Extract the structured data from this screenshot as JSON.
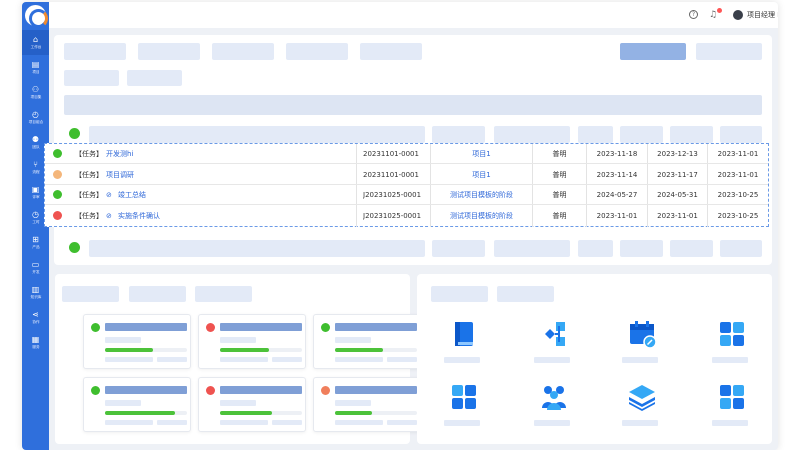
{
  "header": {
    "help_icon": "help-circle-icon",
    "bell_icon": "bell-icon",
    "username": "项目经理 PM"
  },
  "sidebar": {
    "items": [
      {
        "label": "工作台",
        "icon": "home-icon",
        "glyph": "⌂",
        "active": true
      },
      {
        "label": "项目",
        "icon": "project-icon",
        "glyph": "▤",
        "active": false
      },
      {
        "label": "项目集",
        "icon": "program-icon",
        "glyph": "⚇",
        "active": false
      },
      {
        "label": "项目组合",
        "icon": "portfolio-icon",
        "glyph": "◴",
        "active": false
      },
      {
        "label": "团队",
        "icon": "team-icon",
        "glyph": "⚉",
        "active": false
      },
      {
        "label": "流程",
        "icon": "flow-icon",
        "glyph": "⑂",
        "active": false
      },
      {
        "label": "评审",
        "icon": "review-icon",
        "glyph": "▣",
        "active": false
      },
      {
        "label": "工时",
        "icon": "clock-icon",
        "glyph": "◷",
        "active": false
      },
      {
        "label": "产品",
        "icon": "product-icon",
        "glyph": "⊞",
        "active": false
      },
      {
        "label": "开发",
        "icon": "terminal-icon",
        "glyph": "▭",
        "active": false
      },
      {
        "label": "知识库",
        "icon": "book-icon",
        "glyph": "▥",
        "active": false
      },
      {
        "label": "协作",
        "icon": "share-icon",
        "glyph": "⋖",
        "active": false
      },
      {
        "label": "服务",
        "icon": "service-icon",
        "glyph": "▦",
        "active": false
      }
    ]
  },
  "tasks": [
    {
      "status": "green",
      "type": "【任务】",
      "icon": "",
      "title": "开发测hi",
      "code": "20231101-0001",
      "project": "项目1",
      "owner": "普明",
      "start": "2023-11-18",
      "end": "2023-12-13",
      "created": "2023-11-01"
    },
    {
      "status": "orange",
      "type": "【任务】",
      "icon": "",
      "title": "项目调研",
      "code": "20231101-0001",
      "project": "项目1",
      "owner": "普明",
      "start": "2023-11-14",
      "end": "2023-11-17",
      "created": "2023-11-01"
    },
    {
      "status": "green",
      "type": "【任务】",
      "icon": "link-icon",
      "title": "竣工总结",
      "code": "J20231025-0001",
      "project": "测试项目模板的阶段",
      "owner": "普明",
      "start": "2024-05-27",
      "end": "2024-05-31",
      "created": "2023-10-25"
    },
    {
      "status": "red",
      "type": "【任务】",
      "icon": "link-icon",
      "title": "实施条件确认",
      "code": "J20231025-0001",
      "project": "测试项目模板的阶段",
      "owner": "普明",
      "start": "2023-11-01",
      "end": "2023-11-01",
      "created": "2023-10-25"
    }
  ],
  "colors": {
    "sidebar": "#2f6fdc",
    "accent": "#2e67d8",
    "green": "#3fbe2e",
    "orange": "#f4b67b",
    "red": "#ef5350",
    "coral": "#f07f5c",
    "progress": "#4cc23a"
  },
  "project_cards": [
    {
      "status": "green",
      "progress": 0.58
    },
    {
      "status": "red",
      "progress": 0.6
    },
    {
      "status": "green",
      "progress": 0.58
    },
    {
      "status": "green",
      "progress": 0.85
    },
    {
      "status": "red",
      "progress": 0.63
    },
    {
      "status": "coral",
      "progress": 0.45
    }
  ],
  "quick_actions": [
    {
      "icon": "book-icon"
    },
    {
      "icon": "flow-diagram-icon"
    },
    {
      "icon": "calendar-edit-icon"
    },
    {
      "icon": "grid-icon"
    },
    {
      "icon": "apps-icon"
    },
    {
      "icon": "team-icon"
    },
    {
      "icon": "layers-icon"
    },
    {
      "icon": "grid-icon"
    }
  ]
}
